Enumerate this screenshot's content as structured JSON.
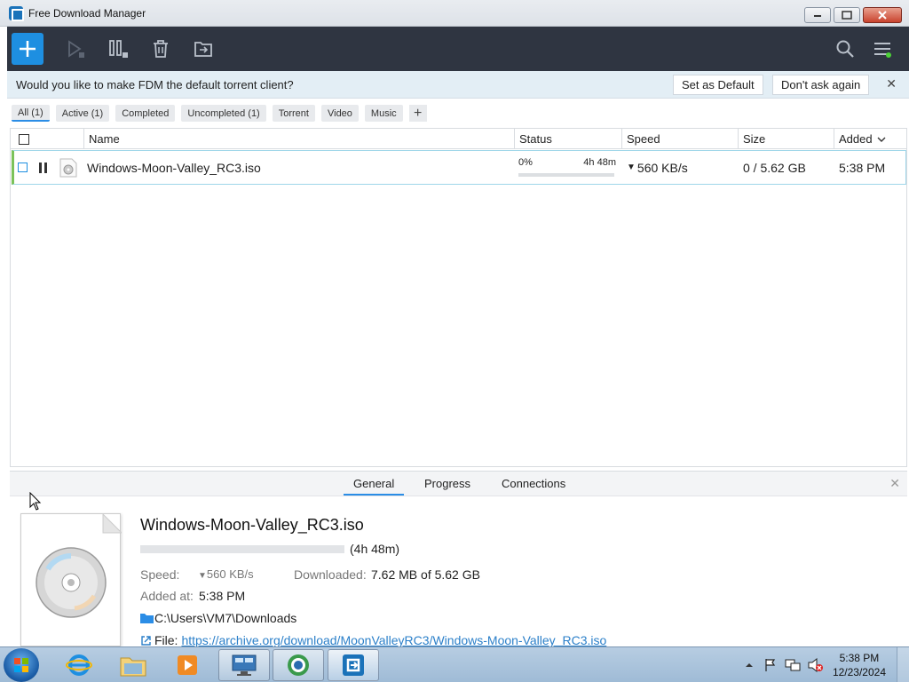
{
  "window": {
    "title": "Free Download Manager"
  },
  "toolbar": {
    "icons": [
      "plus-icon",
      "play-icon",
      "pause-icon",
      "trash-icon",
      "move-folder-icon",
      "search-icon",
      "menu-icon"
    ]
  },
  "banner": {
    "message": "Would you like to make FDM the default torrent client?",
    "set_default": "Set as Default",
    "dont_ask": "Don't ask again",
    "close": "✕"
  },
  "filters": {
    "all": "All (1)",
    "active": "Active (1)",
    "completed": "Completed",
    "uncompleted": "Uncompleted (1)",
    "torrent": "Torrent",
    "video": "Video",
    "music": "Music",
    "add": "+"
  },
  "table": {
    "columns": {
      "name": "Name",
      "status": "Status",
      "speed": "Speed",
      "size": "Size",
      "added": "Added"
    },
    "rows": [
      {
        "name": "Windows-Moon-Valley_RC3.iso",
        "status_percent": "0%",
        "status_time": "4h 48m",
        "speed": "560 KB/s",
        "size": "0 / 5.62 GB",
        "added": "5:38 PM",
        "progress": 0
      }
    ]
  },
  "details": {
    "tabs": {
      "general": "General",
      "progress": "Progress",
      "connections": "Connections"
    },
    "close": "✕",
    "title": "Windows-Moon-Valley_RC3.iso",
    "time_left": "(4h 48m)",
    "speed_label": "Speed:",
    "speed_value": "560 KB/s",
    "downloaded_label": "Downloaded:",
    "downloaded_value": "7.62 MB of 5.62 GB",
    "added_label": "Added at:",
    "added_value": "5:38 PM",
    "folder": "C:\\Users\\VM7\\Downloads",
    "file_label": "File:",
    "file_url": "https://archive.org/download/MoonValleyRC3/Windows-Moon-Valley_RC3.iso"
  },
  "taskbar": {
    "time": "5:38 PM",
    "date": "12/23/2024"
  },
  "colors": {
    "toolbar_bg": "#2f3541",
    "accent": "#1e8fe1",
    "banner_bg": "#e3eef5",
    "row_active_marker": "#7bc25a",
    "link": "#2a7fc9"
  }
}
